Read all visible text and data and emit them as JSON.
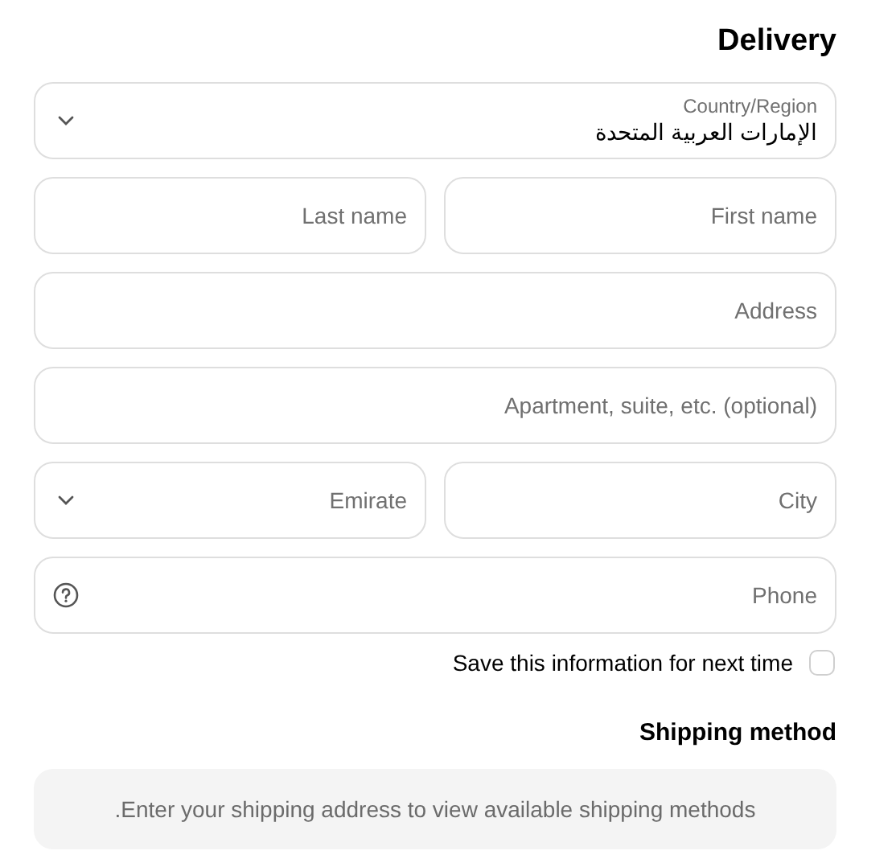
{
  "delivery": {
    "title": "Delivery",
    "rows": [
      [
        {
          "kind": "select",
          "label": "Country/Region",
          "value": "الإمارات العربية المتحدة"
        }
      ],
      [
        {
          "kind": "text",
          "placeholder": "Last name"
        },
        {
          "kind": "text",
          "placeholder": "First name"
        }
      ],
      [
        {
          "kind": "text",
          "placeholder": "Address"
        }
      ],
      [
        {
          "kind": "text",
          "placeholder": "Apartment, suite, etc. (optional)"
        }
      ],
      [
        {
          "kind": "select",
          "placeholder": "Emirate"
        },
        {
          "kind": "text",
          "placeholder": "City"
        }
      ],
      [
        {
          "kind": "phone",
          "placeholder": "Phone"
        }
      ]
    ],
    "save_info": {
      "label": "Save this information for next time",
      "checked": false
    }
  },
  "shipping": {
    "title": "Shipping method",
    "notice": ".Enter your shipping address to view available shipping methods"
  }
}
